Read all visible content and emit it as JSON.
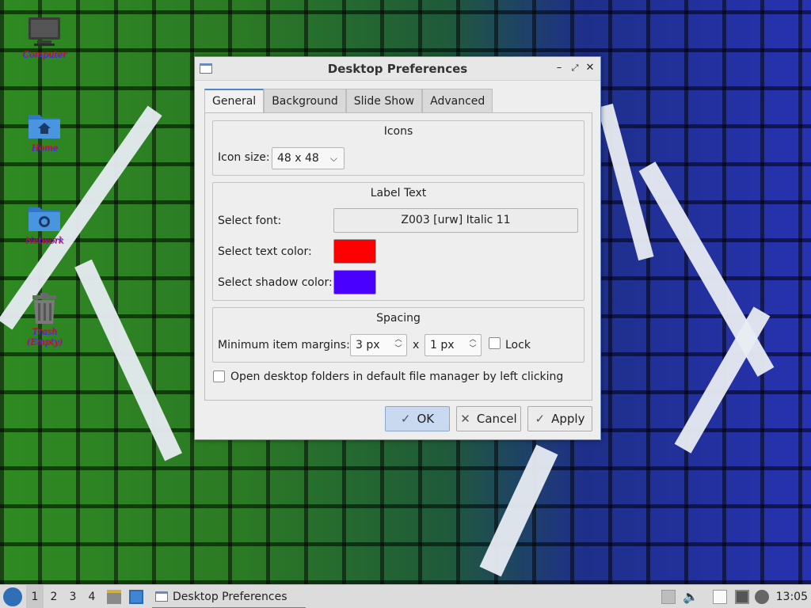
{
  "desktop": {
    "icons": [
      {
        "label": "Computer",
        "icon": "computer-icon"
      },
      {
        "label": "Home",
        "icon": "home-folder-icon"
      },
      {
        "label": "Network",
        "icon": "network-folder-icon"
      },
      {
        "label": "Trash (Empty)",
        "icon": "trash-icon"
      }
    ],
    "label_color": "#e01010",
    "shadow_color": "#4a1cff"
  },
  "dialog": {
    "title": "Desktop Preferences",
    "tabs": [
      {
        "label": "General",
        "active": true
      },
      {
        "label": "Background",
        "active": false
      },
      {
        "label": "Slide Show",
        "active": false
      },
      {
        "label": "Advanced",
        "active": false
      }
    ],
    "icons_section": {
      "title": "Icons",
      "icon_size_label": "Icon size:",
      "icon_size_value": "48 x 48"
    },
    "label_text_section": {
      "title": "Label Text",
      "font_label": "Select font:",
      "font_value": "Z003 [urw] Italic 11",
      "text_color_label": "Select text color:",
      "text_color": "#ff0000",
      "shadow_color_label": "Select shadow color:",
      "shadow_color": "#4a00ff"
    },
    "spacing_section": {
      "title": "Spacing",
      "margins_label": "Minimum item margins:",
      "margin_x": "3 px",
      "separator": "x",
      "margin_y": "1 px",
      "lock_label": "Lock",
      "lock_checked": false
    },
    "open_folders_label": "Open desktop folders in default file manager by left clicking",
    "open_folders_checked": false,
    "buttons": {
      "ok": "OK",
      "cancel": "Cancel",
      "apply": "Apply"
    }
  },
  "taskbar": {
    "workspaces": [
      "1",
      "2",
      "3",
      "4"
    ],
    "active_workspace": "1",
    "task_title": "Desktop Preferences",
    "clock": "13:05"
  }
}
